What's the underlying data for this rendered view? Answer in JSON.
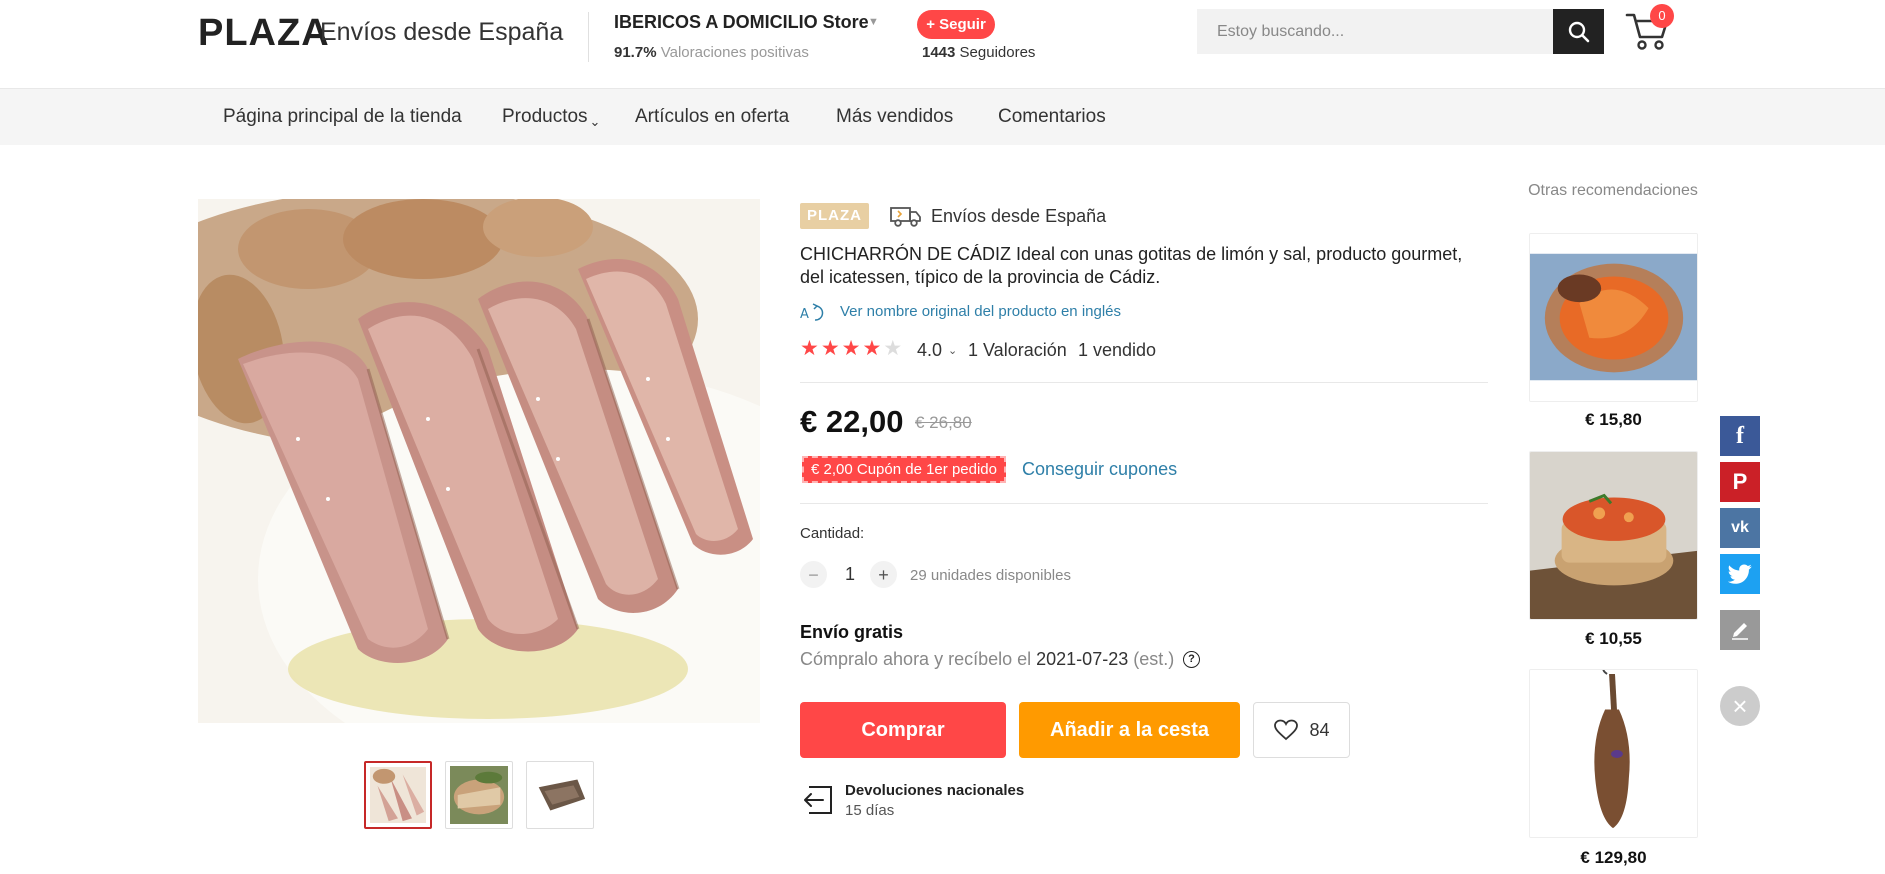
{
  "header": {
    "logo": "PLAZA",
    "logo_sub": "Envíos desde España",
    "store_name": "IBERICOS A DOMICILIO Store",
    "rating_pct": "91.7%",
    "rating_label": "Valoraciones positivas",
    "follow_label": "+ Seguir",
    "followers_count": "1443",
    "followers_label": "Seguidores",
    "search_placeholder": "Estoy buscando...",
    "cart_count": "0"
  },
  "nav": {
    "items": [
      {
        "label": "Página principal de la tienda"
      },
      {
        "label": "Productos"
      },
      {
        "label": "Artículos en oferta"
      },
      {
        "label": "Más vendidos"
      },
      {
        "label": "Comentarios"
      }
    ]
  },
  "product": {
    "badge": "PLAZA",
    "ship_from": "Envíos desde España",
    "title": "CHICHARRÓN DE CÁDIZ Ideal con unas gotitas de limón y sal, producto gourmet, del icatessen, típico de la provincia de Cádiz.",
    "translate_link": "Ver nombre original del producto en inglés",
    "rating_value": "4.0",
    "rating_stars": 4,
    "rating_count": "1 Valoración",
    "sold": "1 vendido",
    "price": "€ 22,00",
    "price_old": "€ 26,80",
    "coupon": "€ 2,00 Cupón de 1er pedido",
    "get_coupons": "Conseguir cupones",
    "quantity_label": "Cantidad:",
    "quantity": "1",
    "quantity_minus": "−",
    "quantity_plus": "+",
    "available": "29 unidades disponibles",
    "shipping_title": "Envío gratis",
    "delivery_prefix": "Cómpralo ahora y recíbelo el",
    "delivery_date": "2021-07-23",
    "delivery_suffix": "(est.)",
    "help_icon_text": "?",
    "buy_label": "Comprar",
    "add_cart_label": "Añadir a la cesta",
    "wishlist_count": "84",
    "returns_title": "Devoluciones nacionales",
    "returns_days": "15 días"
  },
  "recommendations": {
    "title": "Otras recomendaciones",
    "items": [
      {
        "price": "€ 15,80"
      },
      {
        "price": "€ 10,55"
      },
      {
        "price": "€ 129,80"
      }
    ]
  },
  "social": {
    "facebook": "f",
    "pinterest": "P",
    "vk": "vk",
    "close": "×"
  },
  "colors": {
    "accent": "#ff4747",
    "orange": "#ff9a00",
    "link": "#2e7fa8",
    "badge": "#e8cfa3"
  }
}
